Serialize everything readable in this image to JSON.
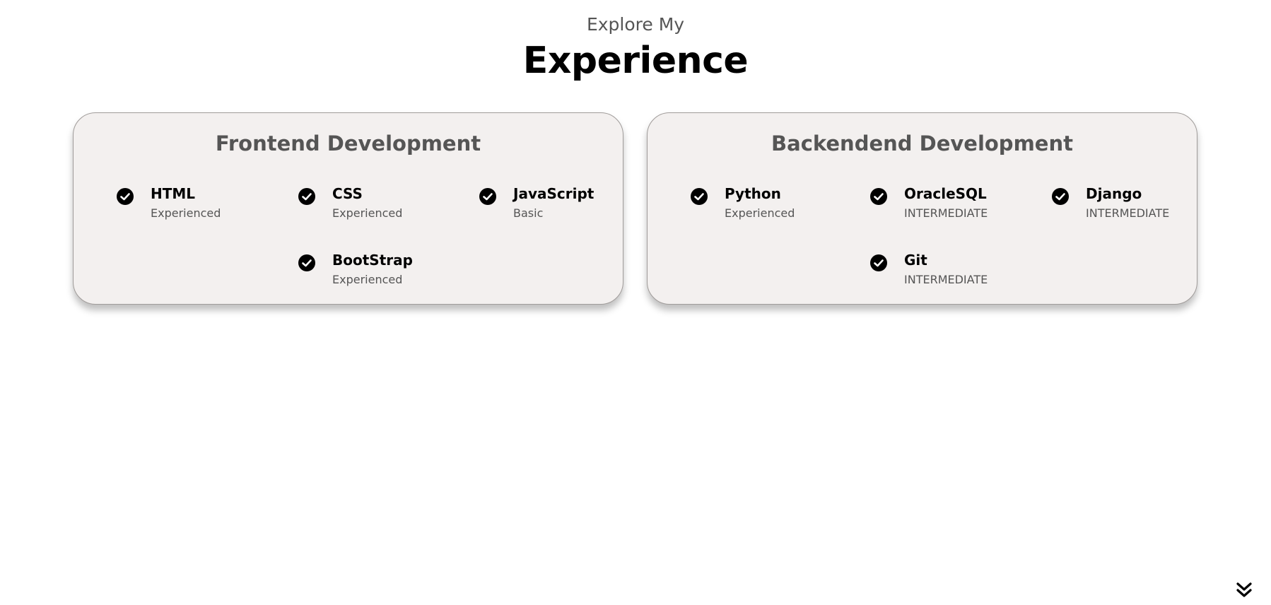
{
  "header": {
    "subtitle": "Explore My",
    "title": "Experience"
  },
  "cards": [
    {
      "title": "Frontend Development",
      "skills": [
        {
          "name": "HTML",
          "level": "Experienced"
        },
        {
          "name": "CSS",
          "level": "Experienced"
        },
        {
          "name": "JavaScript",
          "level": "Basic"
        },
        {
          "name": "BootStrap",
          "level": "Experienced"
        }
      ]
    },
    {
      "title": "Backendend Development",
      "skills": [
        {
          "name": "Python",
          "level": "Experienced"
        },
        {
          "name": "OracleSQL",
          "level": "INTERMEDIATE"
        },
        {
          "name": "Django",
          "level": "INTERMEDIATE"
        },
        {
          "name": "Git",
          "level": "INTERMEDIATE"
        }
      ]
    }
  ],
  "icons": {
    "skill": "checkmark-badge-icon",
    "scroll": "double-chevron-down-icon"
  },
  "colors": {
    "card_background": "#f3f0ef",
    "muted_text": "#555555"
  }
}
